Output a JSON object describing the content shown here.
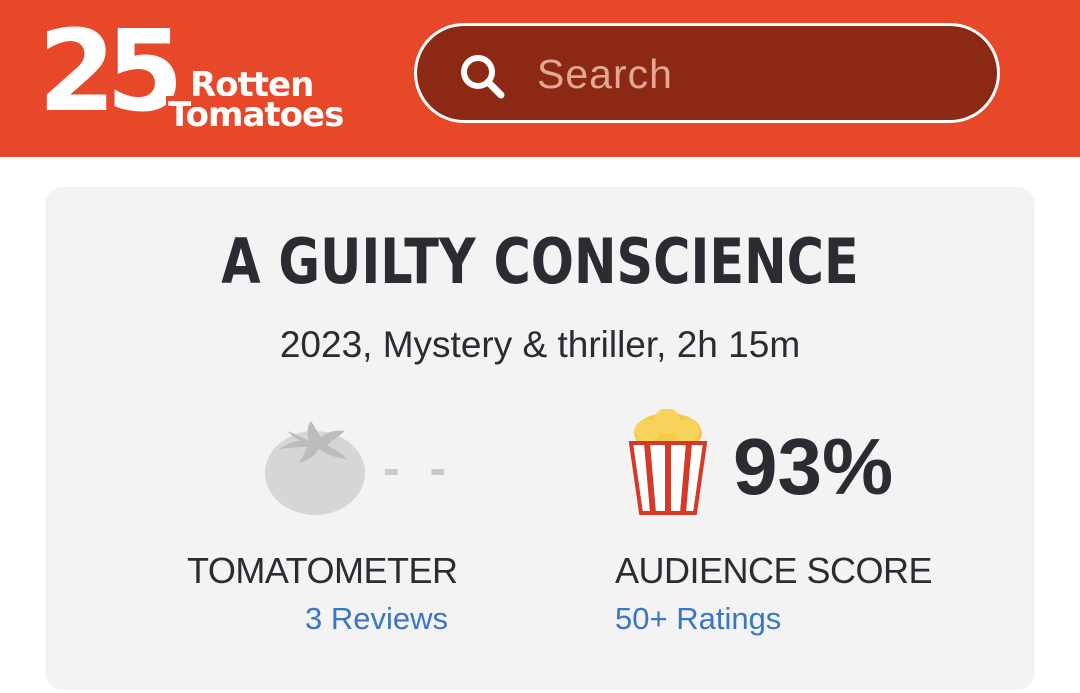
{
  "header": {
    "logo": {
      "number": "25",
      "word1": "Rotten",
      "word2": "Tomatoes",
      "registered_mark": "®"
    },
    "search": {
      "placeholder": "Search",
      "icon": "search-icon"
    },
    "background_color": "#e8482a"
  },
  "movie": {
    "title": "A GUILTY CONSCIENCE",
    "meta": "2023, Mystery & thriller, 2h 15m",
    "tomatometer": {
      "icon": "tomato-empty-icon",
      "score_text": "- -",
      "label": "TOMATOMETER",
      "reviews_link": "3 Reviews"
    },
    "audience": {
      "icon": "popcorn-icon",
      "score_text": "93%",
      "label": "AUDIENCE SCORE",
      "ratings_link": "50+ Ratings"
    }
  },
  "colors": {
    "brand_red": "#e8482a",
    "search_bg": "#8b2915",
    "link_blue": "#3a76c4",
    "text_dark": "#2a2c32",
    "empty_grey": "#d6d6d6"
  }
}
